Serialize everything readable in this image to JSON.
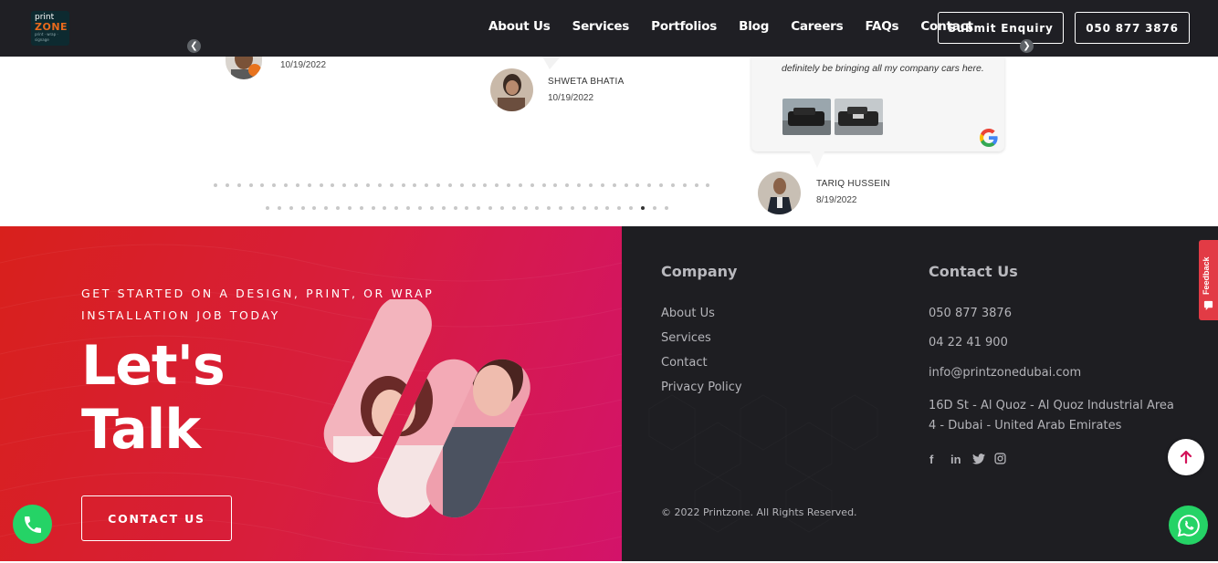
{
  "header": {
    "logo": {
      "line1": "print",
      "line2": "ZONE",
      "tagline": "print · wrap · signage"
    },
    "nav": [
      "About Us",
      "Services",
      "Portfolios",
      "Blog",
      "Careers",
      "FAQs",
      "Contact"
    ],
    "enquiry_button": "Submit Enquiry",
    "phone_button": "050 877 3876"
  },
  "reviews": {
    "items": [
      {
        "name": "",
        "date": "10/19/2022"
      },
      {
        "name": "SHWETA BHATIA",
        "date": "10/19/2022"
      },
      {
        "name": "TARIQ HUSSEIN",
        "date": "8/19/2022",
        "text": "definitely be bringing all my company cars here."
      }
    ],
    "dots_row1": 43,
    "dots_row2": 35,
    "active_dot": 32
  },
  "cta": {
    "subtitle": "GET STARTED ON A DESIGN, PRINT, OR WRAP INSTALLATION JOB TODAY",
    "title_line1": "Let's",
    "title_line2": "Talk",
    "button": "CONTACT US"
  },
  "footer": {
    "company_title": "Company",
    "company_links": [
      "About Us",
      "Services",
      "Contact",
      "Privacy Policy"
    ],
    "contact_title": "Contact Us",
    "phone1": "050 877 3876",
    "phone2": "04 22 41 900",
    "email": "info@printzonedubai.com",
    "address": "16D St - Al Quoz - Al Quoz Industrial Area 4 - Dubai - United Arab Emirates",
    "social": [
      "facebook-icon",
      "linkedin-icon",
      "twitter-icon",
      "instagram-icon"
    ],
    "copyright": "© 2022 Printzone. All Rights Reserved."
  },
  "floating": {
    "feedback": "Feedback"
  },
  "colors": {
    "accent_red": "#d8201c",
    "accent_pink": "#d3136a",
    "dark": "#1e1e22",
    "whatsapp": "#25d366"
  }
}
